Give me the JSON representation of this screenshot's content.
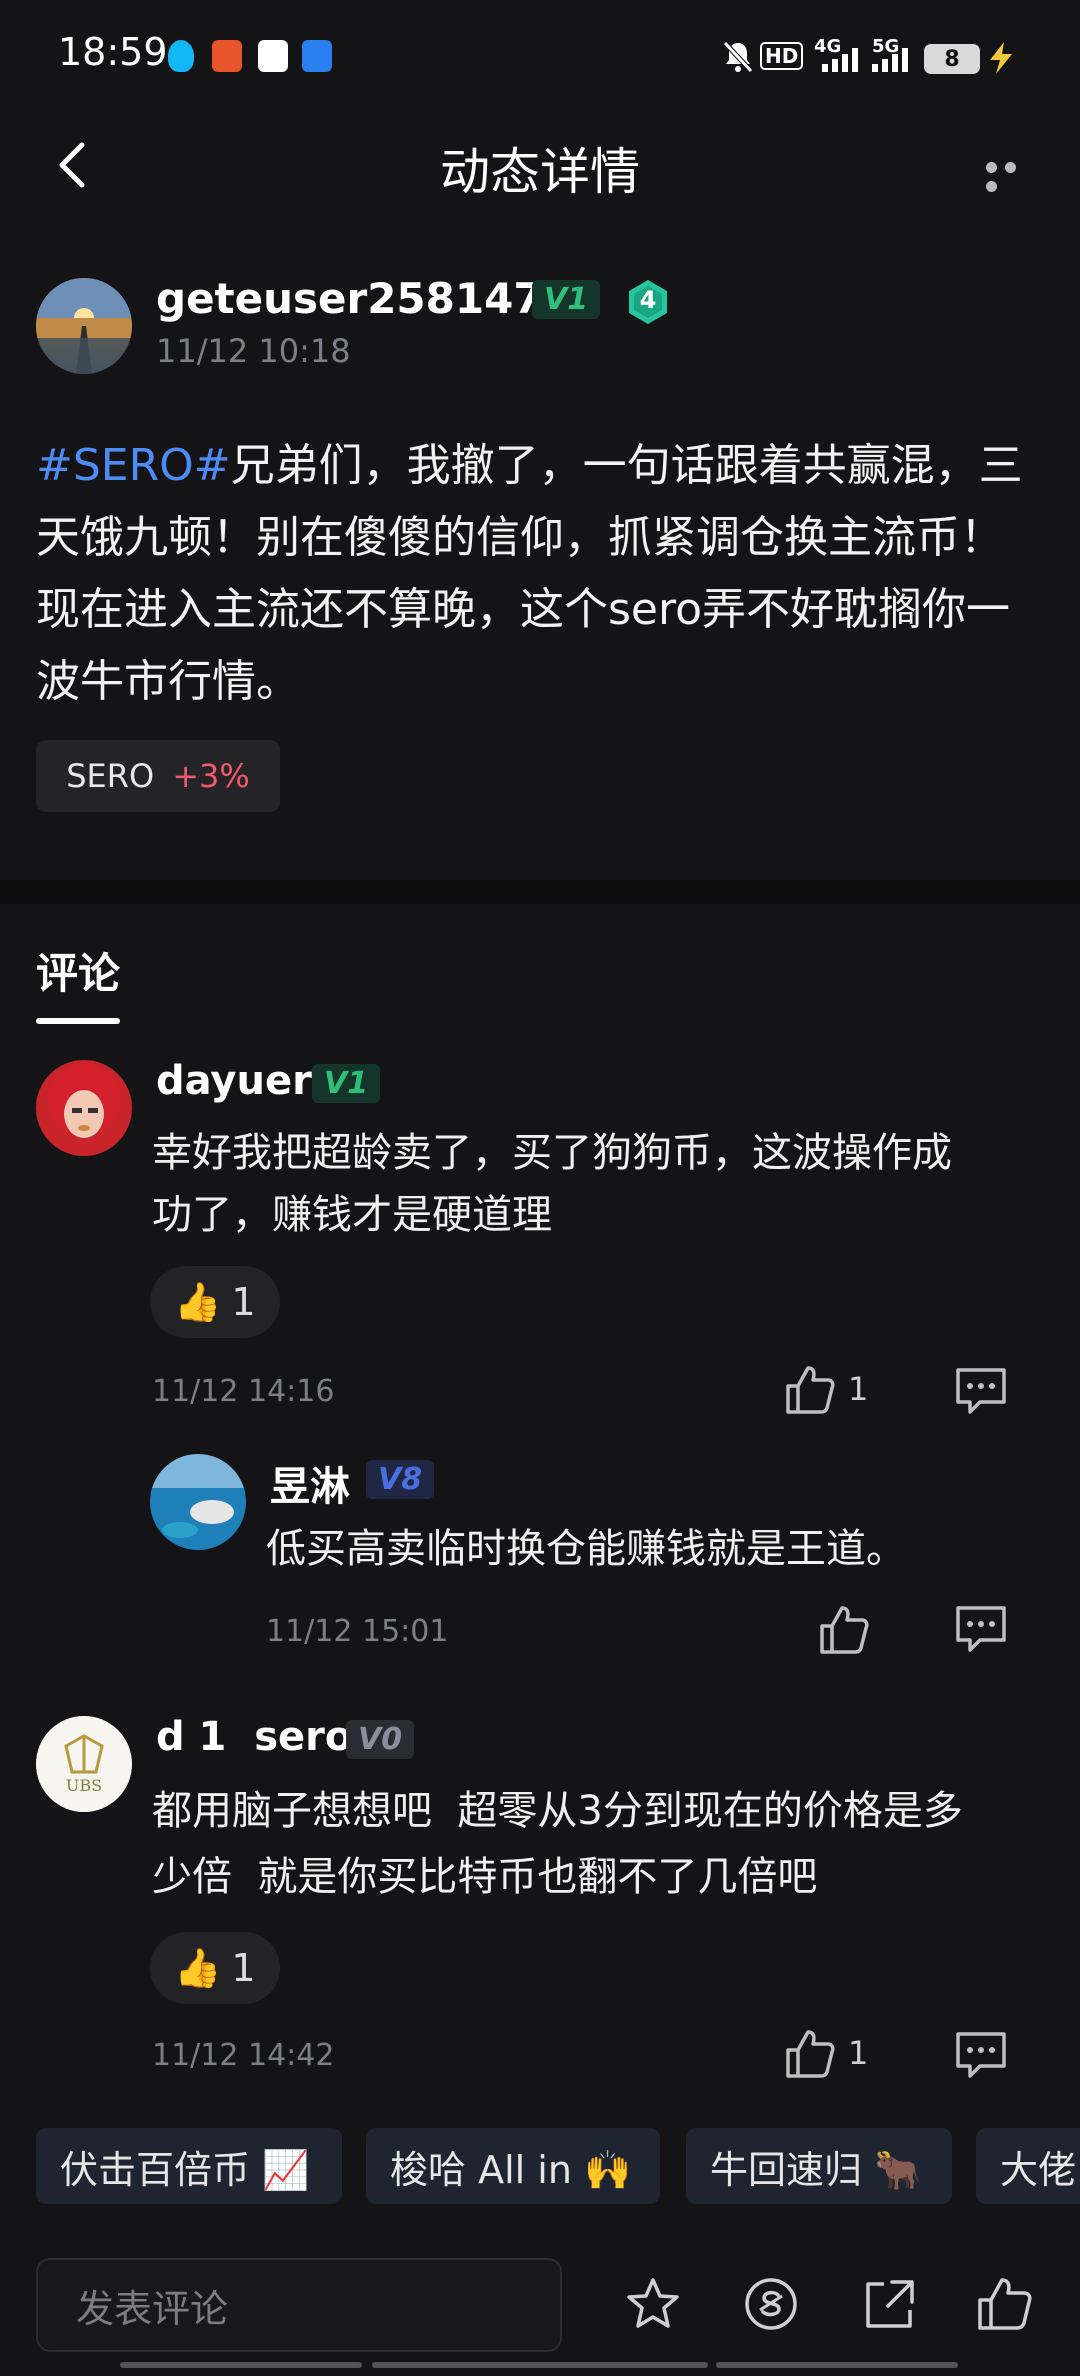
{
  "status_bar": {
    "time": "18:59",
    "battery": "8",
    "network_1": "4G",
    "network_2": "5G",
    "hd": "HD"
  },
  "header": {
    "title": "动态详情"
  },
  "post": {
    "username": "geteuser2581473",
    "vip": "V1",
    "level": "4",
    "time": "11/12 10:18",
    "hashtag": "#SERO#",
    "text": "兄弟们，我撤了，一句话跟着共赢混，三天饿九顿！别在傻傻的信仰，抓紧调仓换主流币！现在进入主流还不算晚，这个sero弄不好耽搁你一波牛市行情。",
    "coin_chip": {
      "symbol": "SERO",
      "change": "+3%"
    }
  },
  "comments_section": {
    "title": "评论"
  },
  "comments": [
    {
      "username": "dayuer",
      "vip": "V1",
      "text_line1": "幸好我把超龄卖了，买了狗狗币，这波操作成",
      "text_line2": "功了，赚钱才是硬道理",
      "reaction_emoji": "👍",
      "reaction_count": "1",
      "time": "11/12 14:16",
      "likes": "1",
      "reply": {
        "username": "昱淋",
        "vip": "V8",
        "text": "低买高卖临时换仓能赚钱就是王道。",
        "time": "11/12 15:01"
      }
    },
    {
      "username": "d 1  sero",
      "vip": "V0",
      "avatar_text": "UBS",
      "text_line1": "都用脑子想想吧  超零从3分到现在的价格是多",
      "text_line2": "少倍  就是你买比特币也翻不了几倍吧",
      "reaction_emoji": "👍",
      "reaction_count": "1",
      "time": "11/12 14:42",
      "likes": "1"
    }
  ],
  "quick_chips": [
    "伏击百倍币 📈",
    "梭哈 All in 🙌",
    "牛回速归 🐂",
    "大佬"
  ],
  "bottom_bar": {
    "input_placeholder": "发表评论"
  },
  "colors": {
    "background": "#141416",
    "accent_blue": "#4d8cf5",
    "up_red": "#ef5a6f",
    "v1_green": "#2fbf7a",
    "v8_blue": "#4b6ee0"
  }
}
